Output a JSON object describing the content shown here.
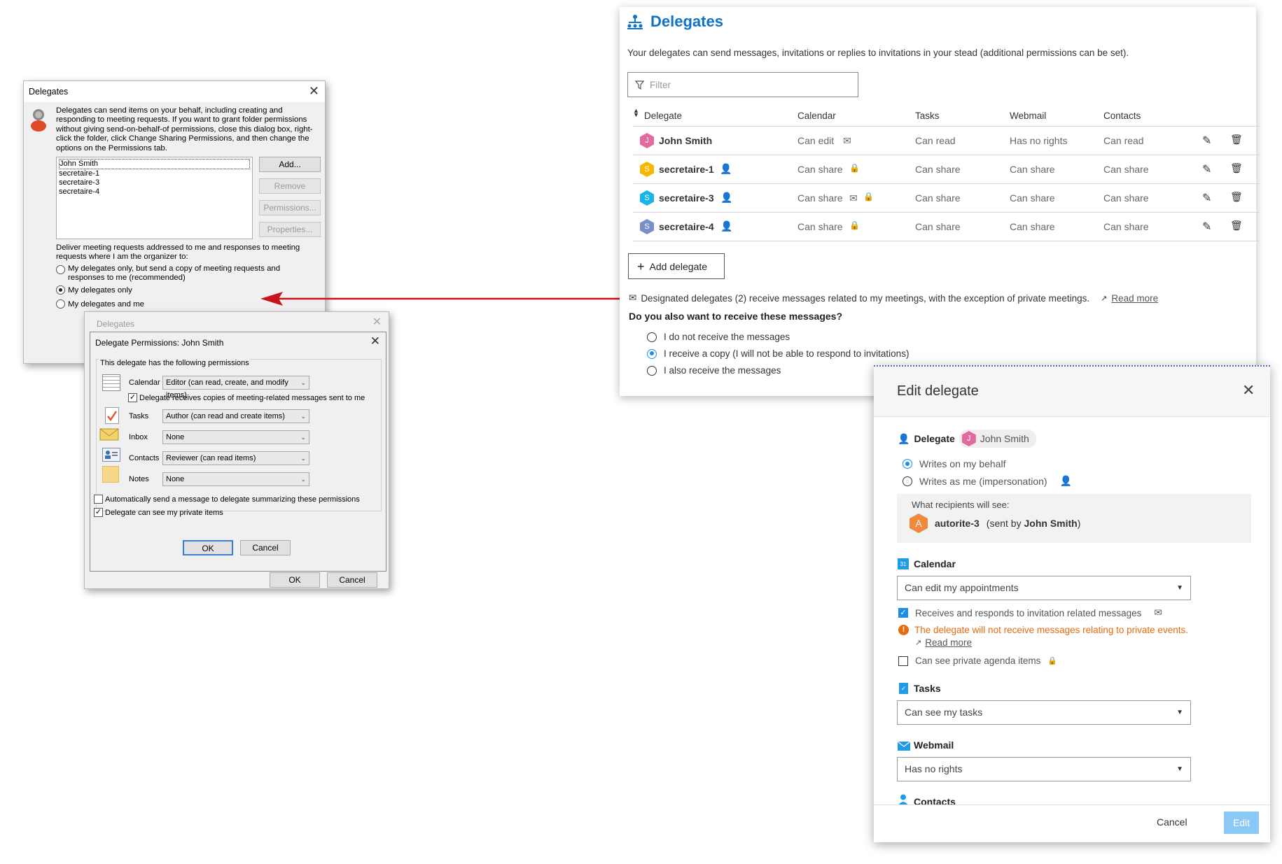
{
  "outlook_delegates": {
    "title": "Delegates",
    "description": "Delegates can send items on your behalf, including creating and responding to meeting requests. If you want to grant folder permissions without giving send-on-behalf-of permissions, close this dialog box, right-click the folder, click Change Sharing Permissions, and then change the options on the Permissions tab.",
    "list": [
      "John Smith",
      "secretaire-1",
      "secretaire-3",
      "secretaire-4"
    ],
    "buttons": {
      "add": "Add...",
      "remove": "Remove",
      "permissions": "Permissions...",
      "properties": "Properties..."
    },
    "deliver_label": "Deliver meeting requests addressed to me and responses to meeting requests where I am the organizer to:",
    "options": [
      "My delegates only, but send a copy of meeting requests and responses to me (recommended)",
      "My delegates only",
      "My delegates and me"
    ],
    "ok": "OK",
    "cancel": "Cancel"
  },
  "outlook_permissions": {
    "ghost_title": "Delegates",
    "title": "Delegate Permissions: John Smith",
    "group": "This delegate has the following permissions",
    "rows": [
      {
        "label": "Calendar",
        "value": "Editor (can read, create, and modify items)",
        "icon": "calendar-icon"
      },
      {
        "label": "Tasks",
        "value": "Author (can read and create items)",
        "icon": "tasks-icon"
      },
      {
        "label": "Inbox",
        "value": "None",
        "icon": "inbox-icon"
      },
      {
        "label": "Contacts",
        "value": "Reviewer (can read items)",
        "icon": "contacts-icon"
      },
      {
        "label": "Notes",
        "value": "None",
        "icon": "notes-icon"
      }
    ],
    "copies_label": "Delegate receives copies of meeting-related messages sent to me",
    "auto_send": "Automatically send a message to delegate summarizing these permissions",
    "private": "Delegate can see my private items",
    "ok": "OK",
    "cancel": "Cancel"
  },
  "web_delegates": {
    "title": "Delegates",
    "subtitle": "Your delegates can send messages, invitations or replies to invitations in your stead (additional permissions can be set).",
    "filter_placeholder": "Filter",
    "headers": {
      "delegate": "Delegate",
      "calendar": "Calendar",
      "tasks": "Tasks",
      "webmail": "Webmail",
      "contacts": "Contacts"
    },
    "rows": [
      {
        "initial": "J",
        "color": "#e26a9c",
        "name": "John Smith",
        "calendar": "Can edit",
        "tasks": "Can read",
        "webmail": "Has no rights",
        "contacts": "Can read"
      },
      {
        "initial": "S",
        "color": "#f5b800",
        "name": "secretaire-1",
        "calendar": "Can share",
        "tasks": "Can share",
        "webmail": "Can share",
        "contacts": "Can share"
      },
      {
        "initial": "S",
        "color": "#19b5e8",
        "name": "secretaire-3",
        "calendar": "Can share",
        "tasks": "Can share",
        "webmail": "Can share",
        "contacts": "Can share"
      },
      {
        "initial": "S",
        "color": "#7a8fc9",
        "name": "secretaire-4",
        "calendar": "Can share",
        "tasks": "Can share",
        "webmail": "Can share",
        "contacts": "Can share"
      }
    ],
    "add_button": "Add delegate",
    "info_text": "Designated delegates (2) receive messages related to my meetings, with the exception of private meetings.",
    "read_more": "Read more",
    "question": "Do you also want to receive these messages?",
    "options": [
      "I do not receive the messages",
      "I receive a copy (I will not be able to respond to invitations)",
      "I also receive the messages"
    ]
  },
  "edit_delegate": {
    "title": "Edit delegate",
    "delegate_label": "Delegate",
    "delegate_initial": "J",
    "delegate_name": "John Smith",
    "mode_options": [
      "Writes on my behalf",
      "Writes as me (impersonation)"
    ],
    "recipients_label": "What recipients will see:",
    "sender_initial": "A",
    "sender_name": "autorite-3",
    "sent_by_prefix": "(sent by ",
    "sent_by_name": "John Smith",
    "sent_by_suffix": ")",
    "calendar_label": "Calendar",
    "calendar_value": "Can edit my appointments",
    "invitations_label": "Receives and responds to invitation related messages",
    "warning": "The delegate will not receive messages relating to private events.",
    "read_more": "Read more",
    "private_label": "Can see private agenda items",
    "tasks_label": "Tasks",
    "tasks_value": "Can see my tasks",
    "webmail_label": "Webmail",
    "webmail_value": "Has no rights",
    "contacts_label": "Contacts",
    "cancel": "Cancel",
    "submit": "Edit"
  },
  "colors": {
    "accent": "#1173c6",
    "warning": "#e86b0d",
    "arrow": "#c8141c"
  }
}
